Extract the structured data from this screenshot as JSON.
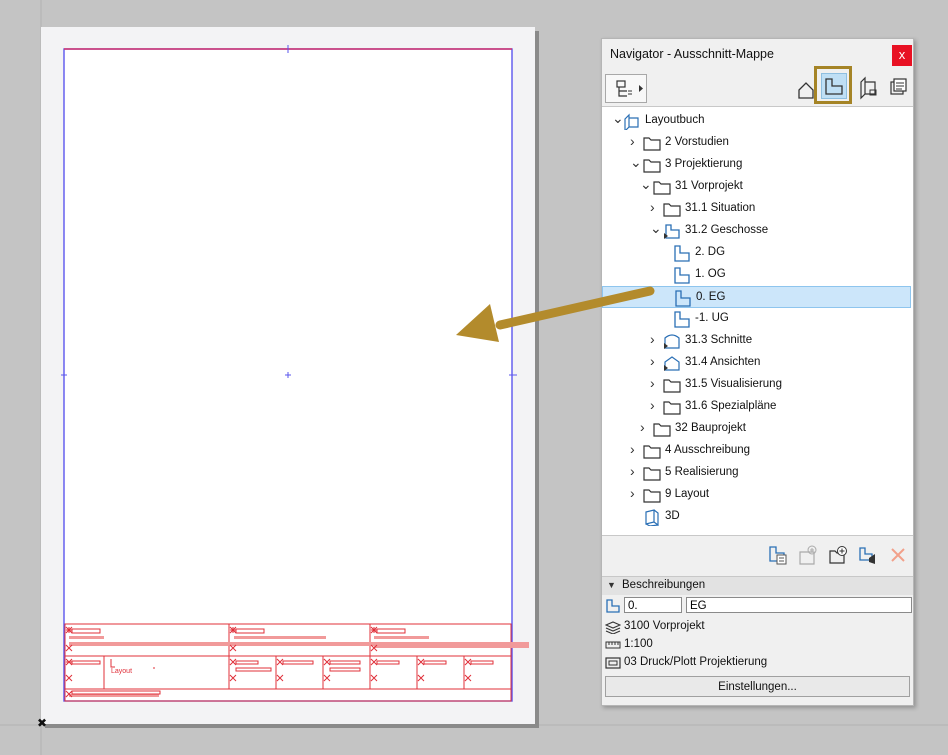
{
  "navigator": {
    "title": "Navigator - Ausschnitt-Mappe",
    "close_label": "x",
    "toolbar": {
      "view_icons": [
        "project-map-icon",
        "view-map-icon",
        "layout-book-icon",
        "publisher-icon"
      ],
      "active_view": "view-map-icon"
    },
    "tree": [
      {
        "label": "Layoutbuch",
        "level": 0,
        "expand": "open",
        "icon": "layout-book-icon"
      },
      {
        "label": "2 Vorstudien",
        "level": 1,
        "expand": "closed",
        "icon": "folder-icon"
      },
      {
        "label": "3 Projektierung",
        "level": 1,
        "expand": "open",
        "icon": "folder-icon"
      },
      {
        "label": "31 Vorprojekt",
        "level": 2,
        "expand": "open",
        "icon": "folder-icon"
      },
      {
        "label": "31.1 Situation",
        "level": 3,
        "expand": "closed",
        "icon": "folder-icon"
      },
      {
        "label": "31.2 Geschosse",
        "level": 3,
        "expand": "open",
        "icon": "floorplan-folder-icon"
      },
      {
        "label": "2. DG",
        "level": 4,
        "expand": "none",
        "icon": "floorplan-icon"
      },
      {
        "label": "1. OG",
        "level": 4,
        "expand": "none",
        "icon": "floorplan-icon"
      },
      {
        "label": "0. EG",
        "level": 4,
        "expand": "none",
        "icon": "floorplan-icon",
        "selected": true
      },
      {
        "label": "-1. UG",
        "level": 4,
        "expand": "none",
        "icon": "floorplan-icon"
      },
      {
        "label": "31.3 Schnitte",
        "level": 3,
        "expand": "closed",
        "icon": "section-folder-icon"
      },
      {
        "label": "31.4 Ansichten",
        "level": 3,
        "expand": "closed",
        "icon": "elevation-folder-icon"
      },
      {
        "label": "31.5 Visualisierung",
        "level": 3,
        "expand": "closed",
        "icon": "folder-icon"
      },
      {
        "label": "31.6 Spezialpläne",
        "level": 3,
        "expand": "closed",
        "icon": "folder-icon"
      },
      {
        "label": "32 Bauprojekt",
        "level": 2,
        "expand": "closed",
        "icon": "folder-icon"
      },
      {
        "label": "4 Ausschreibung",
        "level": 1,
        "expand": "closed",
        "icon": "folder-icon"
      },
      {
        "label": "5 Realisierung",
        "level": 1,
        "expand": "closed",
        "icon": "folder-icon"
      },
      {
        "label": "9 Layout",
        "level": 1,
        "expand": "closed",
        "icon": "folder-icon"
      },
      {
        "label": "3D",
        "level": 1,
        "expand": "none",
        "icon": "3d-icon"
      }
    ],
    "actions": [
      "new-view-icon",
      "clone-view-icon",
      "new-folder-icon",
      "view-settings-icon",
      "delete-icon"
    ],
    "description": {
      "header": "Beschreibungen",
      "id_value": "0.",
      "name_value": "EG",
      "layer_combination": "3100 Vorprojekt",
      "scale": "1:100",
      "pen_set": "03 Druck/Plott Projektierung",
      "settings_button": "Einstellungen..."
    }
  },
  "sheet": {
    "stamp_labels": [
      "Layout"
    ]
  },
  "colors": {
    "accent_arrow": "#b38b2c",
    "selection": "#cce6fa",
    "sheet_border": "#5a55ee",
    "stamp": "#e0303a"
  }
}
